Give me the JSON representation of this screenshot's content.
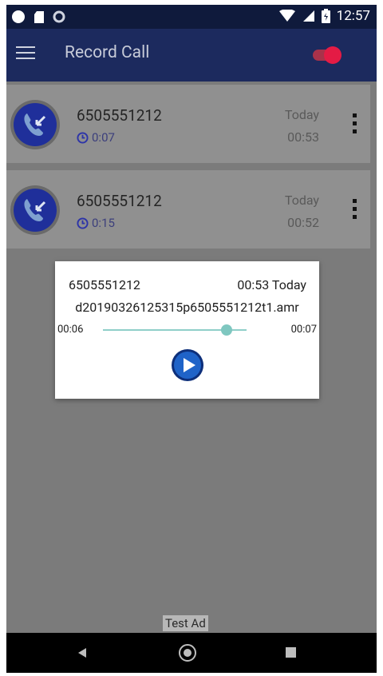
{
  "status_bar": {
    "time": "12:57",
    "icons": [
      "circle-indicator-icon",
      "sd-card-icon",
      "sync-icon",
      "wifi-icon",
      "signal-icon",
      "battery-icon"
    ]
  },
  "app_bar": {
    "title": "Record Call",
    "toggle_on": true,
    "toggle_color": "#e41b45"
  },
  "recordings": [
    {
      "number": "6505551212",
      "duration": "0:07",
      "day": "Today",
      "time": "00:53"
    },
    {
      "number": "6505551212",
      "duration": "0:15",
      "day": "Today",
      "time": "00:52"
    }
  ],
  "player_dialog": {
    "number": "6505551212",
    "when": "00:53 Today",
    "filename": "d20190326125315p6505551212t1.amr",
    "current_time": "00:06",
    "total_time": "00:07",
    "progress_fraction": 0.86
  },
  "ad_label": "Test Ad",
  "colors": {
    "app_bar": "#1c2a5e",
    "status_bar": "#0f1a3c",
    "accent_teal": "#7fc7c0",
    "call_icon_blue": "#1f2f9a"
  }
}
